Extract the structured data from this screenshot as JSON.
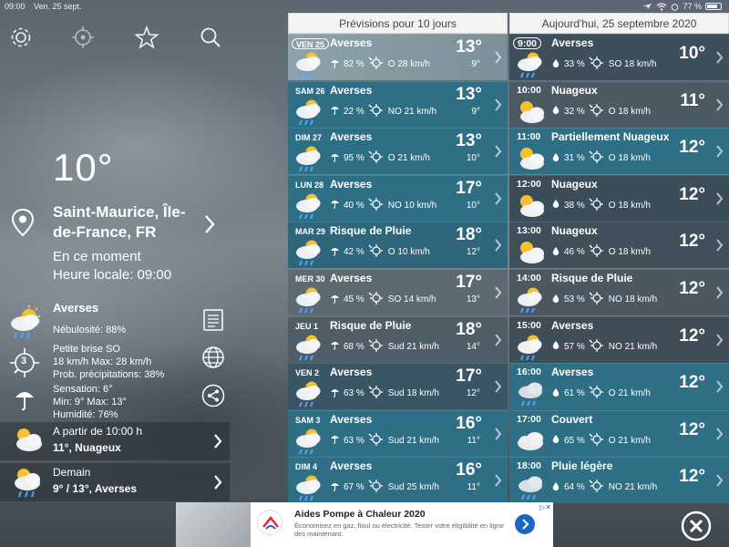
{
  "status": {
    "time": "09:00",
    "date": "Ven. 25 sept.",
    "battery": "77 %",
    "battery_level": 0.77
  },
  "toolbar": {
    "icons": [
      "gear-icon",
      "locate-icon",
      "star-icon",
      "search-icon"
    ]
  },
  "current": {
    "temp": "10°",
    "location": "Saint-Maurice, Île-de-France, FR",
    "now_label": "En ce moment",
    "local_time": "Heure locale: 09:00",
    "condition": "Averses",
    "nebulosity": "Nébulosité: 88%",
    "wind_dir_number": "3",
    "wind1": "Petite brise SO",
    "wind2": "18 km/h Max: 28 km/h",
    "wind3": "Prob. précipitations: 38%",
    "feel1": "Sensation: 6°",
    "feel2": "Min: 9°  Max: 13°",
    "feel3": "Humidité: 76%"
  },
  "side_buttons": [
    "document-icon",
    "globe-icon",
    "share-icon"
  ],
  "next": {
    "l1": "A partir de 10:00 h",
    "l2": "11°, Nuageux"
  },
  "tomorrow": {
    "l1": "Demain",
    "l2": "9° / 13°, Averses"
  },
  "forecast": {
    "header": "Prévisions pour 10 jours",
    "days": [
      {
        "day": "VEN 25",
        "cond": "Averses",
        "icon": "sun-rain",
        "pct": "82 %",
        "wind": "O 28 km/h",
        "high": "13°",
        "low": "9°",
        "selected": true
      },
      {
        "day": "SAM 26",
        "cond": "Averses",
        "icon": "sun-rain",
        "pct": "22 %",
        "wind": "NO 21 km/h",
        "high": "13°",
        "low": "9°"
      },
      {
        "day": "DIM 27",
        "cond": "Averses",
        "icon": "sun-rain",
        "pct": "95 %",
        "wind": "O 21 km/h",
        "high": "13°",
        "low": "10°"
      },
      {
        "day": "LUN 28",
        "cond": "Averses",
        "icon": "sun-rain",
        "pct": "40 %",
        "wind": "NO 10 km/h",
        "high": "17°",
        "low": "10°"
      },
      {
        "day": "MAR 29",
        "cond": "Risque de Pluie",
        "icon": "sun-rain",
        "pct": "42 %",
        "wind": "O 10 km/h",
        "high": "18°",
        "low": "12°"
      },
      {
        "day": "MER 30",
        "cond": "Averses",
        "icon": "sun-rain",
        "pct": "45 %",
        "wind": "SO 14 km/h",
        "high": "17°",
        "low": "13°"
      },
      {
        "day": "JEU 1",
        "cond": "Risque de Pluie",
        "icon": "sun-rain",
        "pct": "68 %",
        "wind": "Sud 21 km/h",
        "high": "18°",
        "low": "14°"
      },
      {
        "day": "VEN 2",
        "cond": "Averses",
        "icon": "sun-rain",
        "pct": "63 %",
        "wind": "Sud 18 km/h",
        "high": "17°",
        "low": "12°"
      },
      {
        "day": "SAM 3",
        "cond": "Averses",
        "icon": "sun-rain",
        "pct": "63 %",
        "wind": "Sud 21 km/h",
        "high": "16°",
        "low": "11°"
      },
      {
        "day": "DIM 4",
        "cond": "Averses",
        "icon": "sun-rain",
        "pct": "67 %",
        "wind": "Sud 25 km/h",
        "high": "16°",
        "low": "11°"
      }
    ]
  },
  "hourly": {
    "header": "Aujourd'hui, 25 septembre 2020",
    "hours": [
      {
        "time": "9:00",
        "cond": "Averses",
        "icon": "sun-rain",
        "pct": "33 %",
        "wind": "SO 18 km/h",
        "temp": "10°",
        "selected": true
      },
      {
        "time": "10:00",
        "cond": "Nuageux",
        "icon": "sun-cloud",
        "pct": "32 %",
        "wind": "O 18 km/h",
        "temp": "11°"
      },
      {
        "time": "11:00",
        "cond": "Partiellement Nuageux",
        "icon": "sun-cloud",
        "pct": "31 %",
        "wind": "O 18 km/h",
        "temp": "12°"
      },
      {
        "time": "12:00",
        "cond": "Nuageux",
        "icon": "sun-cloud",
        "pct": "38 %",
        "wind": "O 18 km/h",
        "temp": "12°"
      },
      {
        "time": "13:00",
        "cond": "Nuageux",
        "icon": "sun-cloud",
        "pct": "46 %",
        "wind": "O 18 km/h",
        "temp": "12°"
      },
      {
        "time": "14:00",
        "cond": "Risque de Pluie",
        "icon": "sun-rain",
        "pct": "53 %",
        "wind": "NO 18 km/h",
        "temp": "12°"
      },
      {
        "time": "15:00",
        "cond": "Averses",
        "icon": "sun-rain",
        "pct": "57 %",
        "wind": "NO 21 km/h",
        "temp": "12°"
      },
      {
        "time": "16:00",
        "cond": "Averses",
        "icon": "cloud-rain",
        "pct": "61 %",
        "wind": "O 21 km/h",
        "temp": "12°"
      },
      {
        "time": "17:00",
        "cond": "Couvert",
        "icon": "cloud",
        "pct": "65 %",
        "wind": "O 21 km/h",
        "temp": "12°"
      },
      {
        "time": "18:00",
        "cond": "Pluie légère",
        "icon": "cloud-rain",
        "pct": "64 %",
        "wind": "NO 21 km/h",
        "temp": "12°"
      }
    ]
  },
  "ad": {
    "title": "Aides Pompe à Chaleur 2020",
    "text": "Économisez en gaz, fioul ou électricité. Tester votre éligibilité en ligne des maintenant."
  },
  "colors": {
    "row_dark": "#3a5564",
    "row_teal": "#2f6f86",
    "row_gray": "#5c6a72",
    "header_bg": "#f3f3f3"
  }
}
